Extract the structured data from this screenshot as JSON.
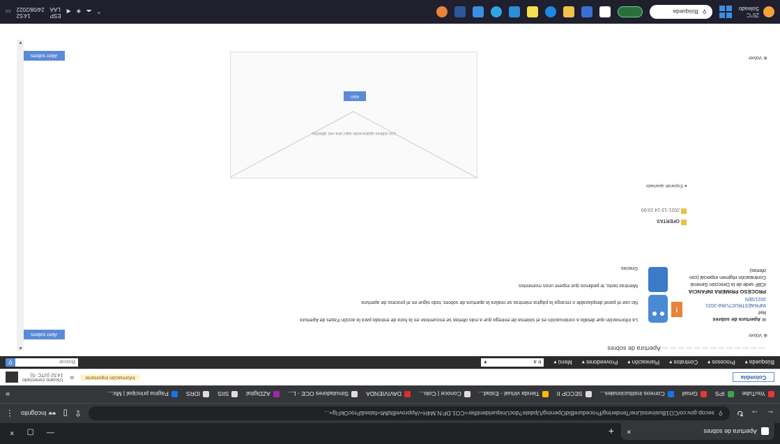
{
  "browser": {
    "tab_title": "Apertura de sobres",
    "new_tab": "+",
    "close_tab": "×",
    "window_controls": [
      "—",
      "▢",
      "×"
    ],
    "url": "secop.gov.co/CO1BusinessLine/Tendering/ProcedureBidOpening/Update?docUniqueIdentifier=CO1.DP.N.M4H=/ApproveBtdMt=false&ProcOkFlg=...",
    "incognito_label": "Incógnito",
    "bookmarks": [
      {
        "label": "YouTube",
        "color": "#e53935"
      },
      {
        "label": "IPS",
        "color": "#34a853"
      },
      {
        "label": "Gmail",
        "color": "#e53935"
      },
      {
        "label": "Correos institucionales...",
        "color": "#1a73e8"
      },
      {
        "label": "SECOP II",
        "color": "#dddddd"
      },
      {
        "label": "Tienda virtual - Estad...",
        "color": "#fbbc04"
      },
      {
        "label": "Conoce | Colo...",
        "color": "#dddddd"
      },
      {
        "label": "DAVIVIENDA",
        "color": "#d93025"
      },
      {
        "label": "Simuladores OCE - L...",
        "color": "#dddddd"
      },
      {
        "label": "AZDigital",
        "color": "#9c27b0"
      },
      {
        "label": "SIIS",
        "color": "#dddddd"
      },
      {
        "label": "IDRS",
        "color": "#dddddd"
      },
      {
        "label": "Página principal | Mic...",
        "color": "#1a73e8"
      }
    ],
    "bookmarks_more": "»"
  },
  "secop": {
    "logo": "Colombia",
    "notice": "Información importante",
    "user_name": "Usuario conectado",
    "user_time": "14:52 (UTC -5)",
    "menu": [
      "Búsqueda",
      "Procesos",
      "Contratos",
      "Planeación",
      "Proveedores",
      "Menú"
    ],
    "menu_box_value": "Ir a",
    "search_placeholder": "Buscar"
  },
  "page": {
    "breadcrumb_title": "Apertura de sobres",
    "volver": "Volver",
    "actions_button": "Abrir sobres",
    "process_heading": "Apertura de sobres",
    "ref_label": "Ref",
    "ref_number": "INFRAESTRUCTURA-2021",
    "ref_code": "2021SEN",
    "process_name": "PROCESO PRIMERA INFANCIA",
    "entity": "ICBF sede de la Dirección General",
    "modality": "Contratación régimen especial (con ofertas)",
    "info_text": "La información que detalla a continuación es el sistema de entrega que a más ofertas se encuentran en la hora de entrada para la acción Fases de Apertura",
    "info_text_2": "No use el panel desplazable o recarga la página mientras se realiza la apertura de sobres; todo sigue en el proceso de apertura",
    "info_text_3": "Mientras tanto, le pedimos que espere unos momentos",
    "gracias": "Gracias",
    "assistant_badge": "!",
    "ofertas_title": "OFERTAS",
    "oferta_date": "2021-12-14 10:00",
    "expand": "Expandir apartado",
    "panel_text": "Los sobres aparecerán aquí una vez abiertos",
    "panel_button": "Abrir"
  },
  "taskbar": {
    "weather_temp": "25°C",
    "weather_desc": "Soleado",
    "search_placeholder": "Búsqueda",
    "lang": "ESP",
    "lang_sub": "LAA",
    "time": "14:52",
    "date": "24/08/2022"
  }
}
